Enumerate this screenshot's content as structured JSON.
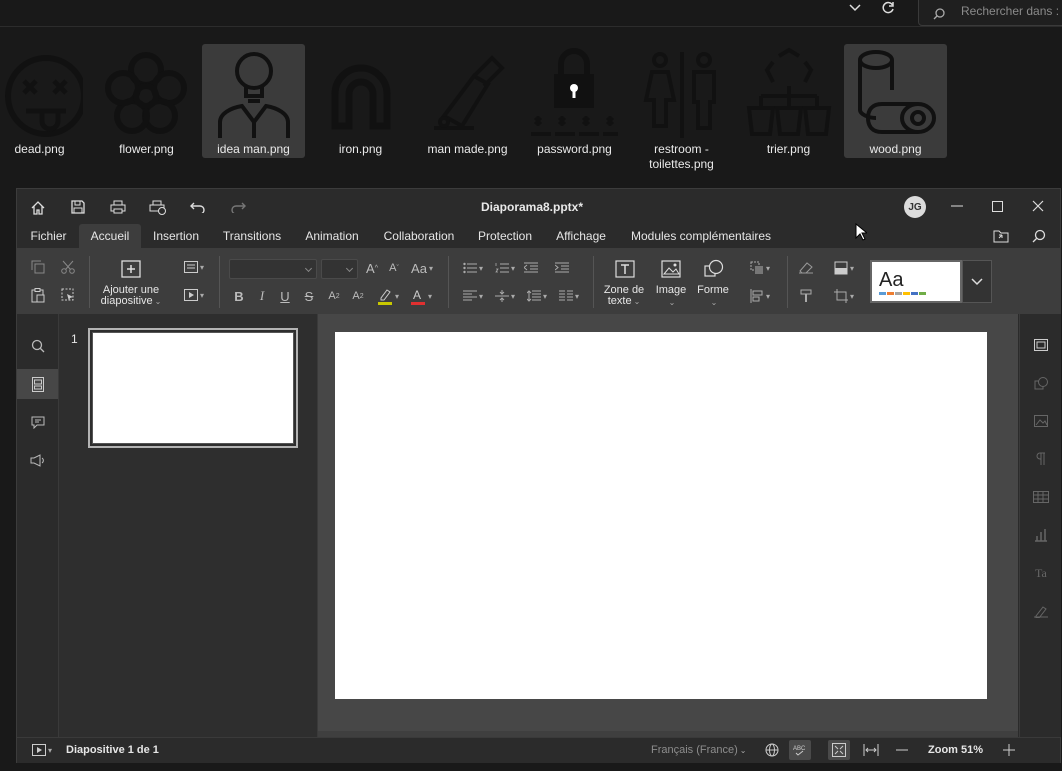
{
  "explorer": {
    "search_placeholder": "Rechercher dans : Je",
    "files": [
      {
        "name": "dead.png",
        "icon": "dead-face-icon",
        "selected": false
      },
      {
        "name": "flower.png",
        "icon": "flower-icon",
        "selected": false
      },
      {
        "name": "idea man.png",
        "icon": "idea-man-icon",
        "selected": true
      },
      {
        "name": "iron.png",
        "icon": "horseshoe-icon",
        "selected": false
      },
      {
        "name": "man made.png",
        "icon": "man-made-icon",
        "selected": false
      },
      {
        "name": "password.png",
        "icon": "password-lock-icon",
        "selected": false
      },
      {
        "name": "restroom - toilettes.png",
        "icon": "restroom-icon",
        "selected": false
      },
      {
        "name": "trier.png",
        "icon": "recycle-sort-icon",
        "selected": false
      },
      {
        "name": "wood.png",
        "icon": "wood-logs-icon",
        "selected": true
      }
    ]
  },
  "app": {
    "title": "Diaporama8.pptx*",
    "avatar_initials": "JG",
    "menu": [
      "Fichier",
      "Accueil",
      "Insertion",
      "Transitions",
      "Animation",
      "Collaboration",
      "Protection",
      "Affichage",
      "Modules complémentaires"
    ],
    "active_menu": "Accueil",
    "toolbar": {
      "add_slide_line1": "Ajouter une",
      "add_slide_line2": "diapositive",
      "textbox_line1": "Zone de",
      "textbox_line2": "texte",
      "image_label": "Image",
      "shape_label": "Forme",
      "style_preview_text": "Aa",
      "style_swatches": [
        "#5b9bd5",
        "#ed7d31",
        "#a5a5a5",
        "#ffc000",
        "#4472c4",
        "#70ad47"
      ]
    },
    "slides": [
      {
        "number": "1"
      }
    ],
    "status": {
      "slide_info": "Diapositive 1 de 1",
      "language": "Français (France)",
      "zoom": "Zoom 51%"
    },
    "colors": {
      "window_bg": "#2b2b2b",
      "ribbon_bg": "#3d3d3d",
      "editor_bg": "#474747",
      "highlight_underline": "#c8c800",
      "font_color_underline": "#e03030"
    }
  }
}
